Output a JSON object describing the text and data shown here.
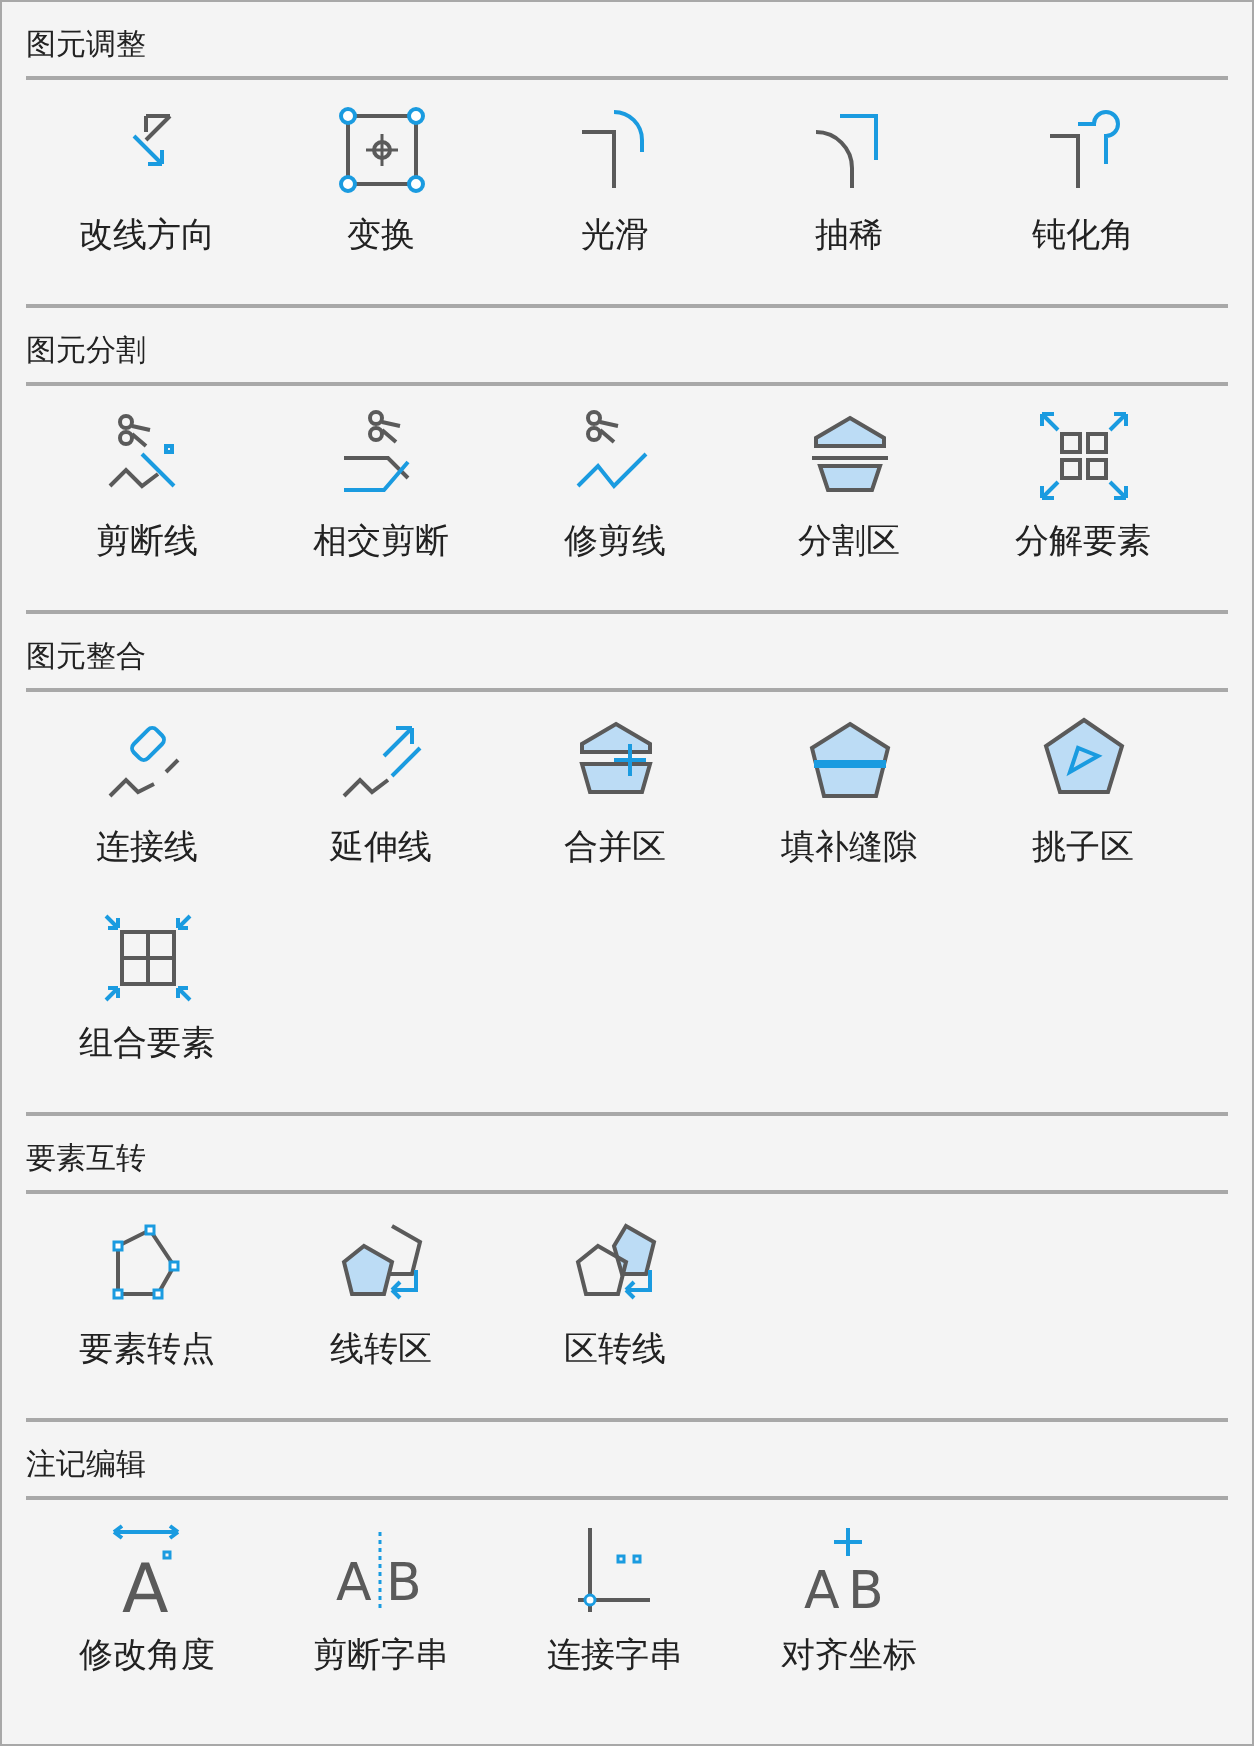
{
  "sections": [
    {
      "title": "图元调整",
      "items": [
        {
          "label": "改线方向"
        },
        {
          "label": "变换"
        },
        {
          "label": "光滑"
        },
        {
          "label": "抽稀"
        },
        {
          "label": "钝化角"
        }
      ]
    },
    {
      "title": "图元分割",
      "items": [
        {
          "label": "剪断线"
        },
        {
          "label": "相交剪断"
        },
        {
          "label": "修剪线"
        },
        {
          "label": "分割区"
        },
        {
          "label": "分解要素"
        }
      ]
    },
    {
      "title": "图元整合",
      "items": [
        {
          "label": "连接线"
        },
        {
          "label": "延伸线"
        },
        {
          "label": "合并区"
        },
        {
          "label": "填补缝隙"
        },
        {
          "label": "挑子区"
        },
        {
          "label": "组合要素"
        }
      ]
    },
    {
      "title": "要素互转",
      "items": [
        {
          "label": "要素转点"
        },
        {
          "label": "线转区"
        },
        {
          "label": "区转线"
        }
      ]
    },
    {
      "title": "注记编辑",
      "items": [
        {
          "label": "修改角度",
          "icon_text": [
            "A"
          ]
        },
        {
          "label": "剪断字串",
          "icon_text": [
            "A",
            "B"
          ]
        },
        {
          "label": "连接字串"
        },
        {
          "label": "对齐坐标",
          "icon_text": [
            "A",
            "B"
          ]
        }
      ]
    }
  ]
}
